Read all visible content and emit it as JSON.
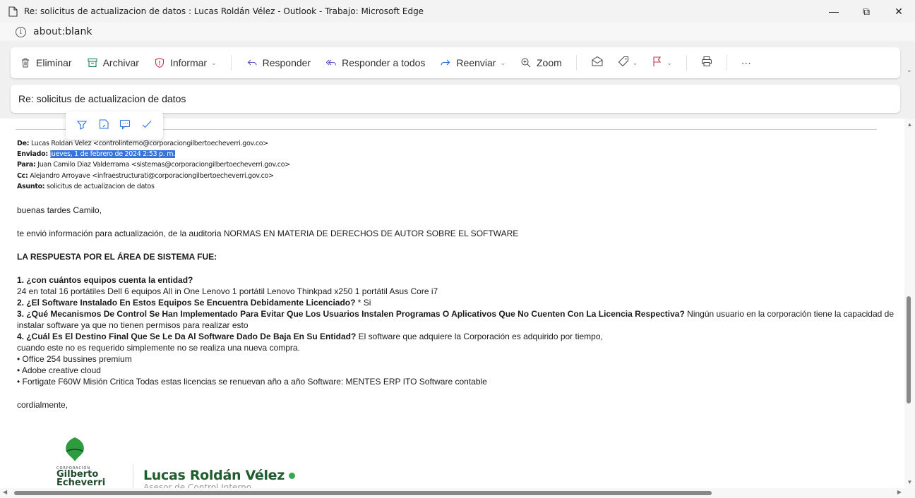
{
  "window": {
    "title": "Re: solicitus de actualizacion de datos : Lucas Roldán Vélez - Outlook - Trabajo: Microsoft Edge",
    "minimize": "—",
    "restore": "⧉",
    "close": "✕"
  },
  "address": {
    "prefix": "about:",
    "host": "blank"
  },
  "toolbar": {
    "delete": "Eliminar",
    "archive": "Archivar",
    "report": "Informar",
    "reply": "Responder",
    "reply_all": "Responder a todos",
    "forward": "Reenviar",
    "zoom": "Zoom",
    "more": "···"
  },
  "subject": "Re: solicitus de actualizacion de datos",
  "header": {
    "from_label": "De:",
    "from_value": "Lucas Roldan Velez <controlinterno@corporaciongilbertoecheverri.gov.co>",
    "sent_label": "Enviado:",
    "sent_value": "jueves, 1 de febrero de 2024 2:53 p. m.",
    "to_label": "Para:",
    "to_value": "Juan Camilo Diaz Valderrama <sistemas@corporaciongilbertoecheverri.gov.co>",
    "cc_label": "Cc:",
    "cc_value": "Alejandro Arroyave <infraestructurati@corporaciongilbertoecheverri.gov.co>",
    "subject_label": "Asunto:",
    "subject_value": "solicitus de actualizacion de datos"
  },
  "body": {
    "greeting": "buenas tardes Camilo,",
    "intro": "te envió información para actualización, de la auditoria NORMAS EN MATERIA DE DERECHOS DE AUTOR SOBRE EL SOFTWARE",
    "heading": "LA RESPUESTA POR EL ÁREA DE SISTEMA FUE:",
    "q1": "1. ¿con cuántos equipos cuenta la entidad?",
    "a1": " 24 en total 16 portátiles Dell 6 equipos All in One Lenovo 1 portátil Lenovo Thinkpad x250 1 portátil Asus Core i7",
    "q2": "2. ¿El Software Instalado En Estos Equipos Se Encuentra Debidamente Licenciado?",
    "a2": " * Si",
    "q3": "3. ¿Qué Mecanismos De Control Se Han Implementado Para Evitar Que Los Usuarios Instalen Programas O Aplicativos Que No Cuenten Con La Licencia Respectiva?",
    "a3a": " Ningún usuario en la corporación tiene la capacidad de",
    "a3b": "instalar software ya que no tienen permisos para realizar esto",
    "q4": "4. ¿Cuál Es El Destino Final Que Se Le Da Al Software Dado De Baja En Su Entidad?",
    "a4a": " El software que adquiere la Corporación es adquirido por tiempo,",
    "a4b": "cuando este no es requerido simplemente no se realiza una nueva compra.",
    "b1": "• Office 254 bussines premium",
    "b2": "• Adobe creative cloud",
    "b3": "• Fortigate F60W Misión Critica Todas estas licencias se renuevan año a año Software: MENTES ERP ITO Software contable",
    "closing": "cordialmente,"
  },
  "signature": {
    "logo_corp": "CORPORACIÓN",
    "logo_line1": "Gilberto",
    "logo_line2": "Echeverri",
    "name": "Lucas Roldán Vélez",
    "role": "Asesor de Control Interno"
  },
  "colors": {
    "accent": "#0f6cbd",
    "selection": "#3574d9",
    "brand_green": "#1f5c2e"
  }
}
